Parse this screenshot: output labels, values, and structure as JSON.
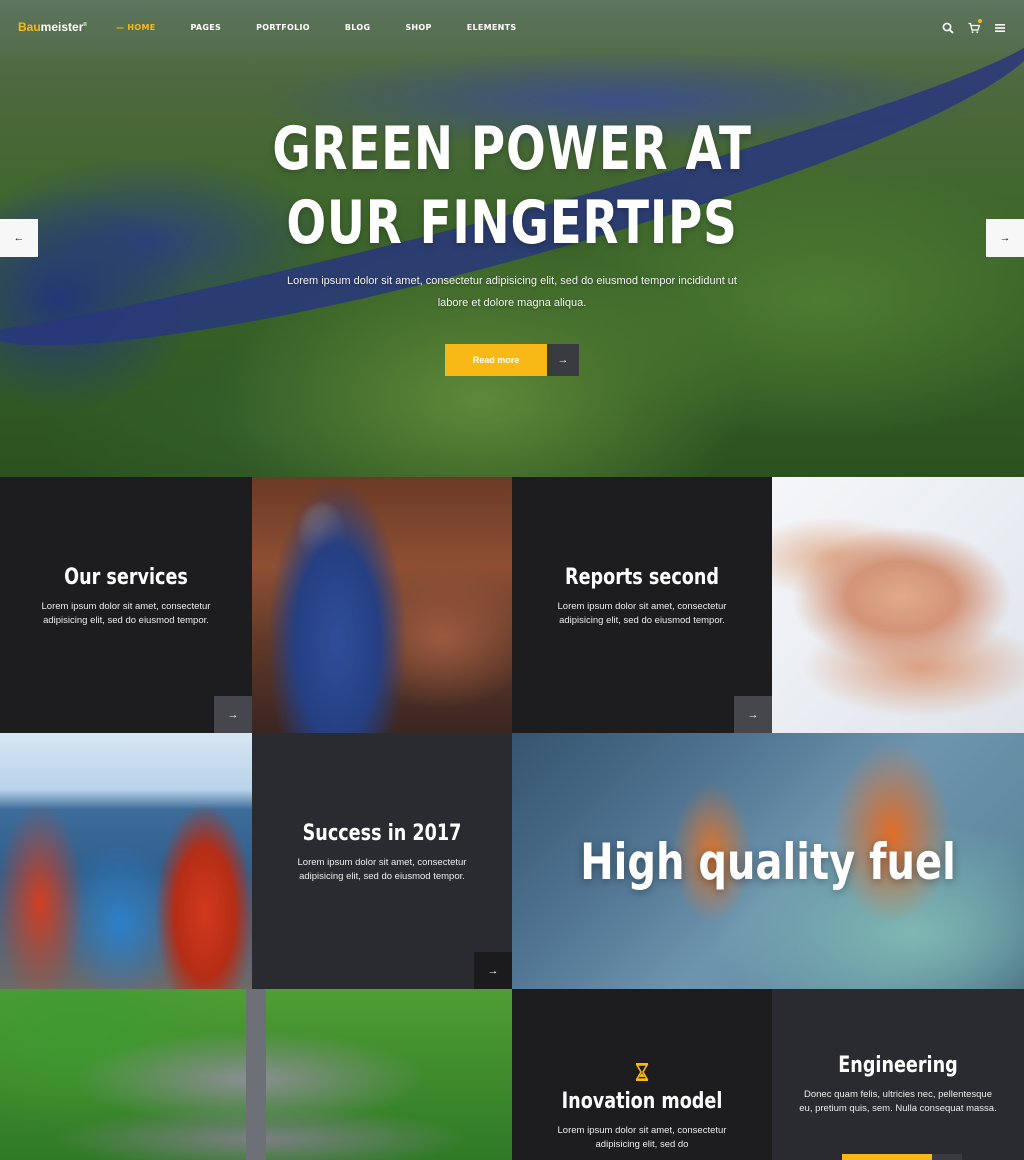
{
  "brand": {
    "logo_part1": "Bau",
    "logo_part2": "meister",
    "logo_mark": "®",
    "accent_color": "#f8b916"
  },
  "nav": {
    "items": [
      {
        "label": "HOME",
        "active": true
      },
      {
        "label": "PAGES",
        "active": false
      },
      {
        "label": "PORTFOLIO",
        "active": false
      },
      {
        "label": "BLOG",
        "active": false
      },
      {
        "label": "SHOP",
        "active": false
      },
      {
        "label": "ELEMENTS",
        "active": false
      }
    ],
    "icons": [
      "search-icon",
      "cart-icon",
      "hamburger-menu-icon"
    ]
  },
  "hero": {
    "title_line1": "GREEN POWER AT",
    "title_line2": "OUR FINGERTIPS",
    "subtitle": "Lorem ipsum dolor sit amet, consectetur adipisicing elit, sed do eiusmod tempor incididunt ut labore et dolore magna aliqua.",
    "button_label": "Read more",
    "prev_arrow": "←",
    "next_arrow": "→"
  },
  "tiles": {
    "services": {
      "title": "Our services",
      "desc": "Lorem ipsum dolor sit amet, consectetur adipisicing elit, sed do eiusmod tempor."
    },
    "reports": {
      "title": "Reports second",
      "desc": "Lorem ipsum dolor sit amet, consectetur adipisicing elit, sed do eiusmod tempor."
    },
    "success": {
      "title": "Success in 2017",
      "desc": "Lorem ipsum dolor sit amet, consectetur adipisicing elit, sed do eiusmod tempor."
    },
    "fuel": {
      "title": "High quality fuel"
    },
    "inovation": {
      "title": "Inovation model",
      "desc": "Lorem ipsum dolor sit amet, consectetur adipisicing elit, sed do"
    },
    "engineering": {
      "title": "Engineering",
      "desc": "Donec quam felis, ultricies nec, pellentesque eu, pretium quis, sem. Nulla consequat massa."
    }
  },
  "arrow_glyph": "→"
}
